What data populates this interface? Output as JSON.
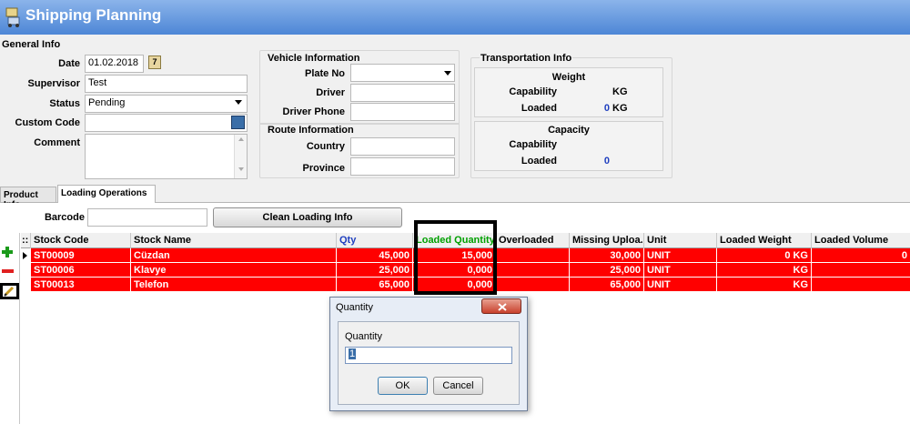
{
  "app": {
    "title": "Shipping Planning"
  },
  "general": {
    "section_title": "General Info",
    "date_label": "Date",
    "date_value": "01.02.2018",
    "supervisor_label": "Supervisor",
    "supervisor_value": "Test",
    "status_label": "Status",
    "status_value": "Pending",
    "custom_code_label": "Custom Code",
    "custom_code_value": "",
    "comment_label": "Comment",
    "comment_value": ""
  },
  "vehicle": {
    "section_title": "Vehicle Information",
    "plate_label": "Plate No",
    "plate_value": "",
    "driver_label": "Driver",
    "driver_value": "",
    "phone_label": "Driver Phone",
    "phone_value": ""
  },
  "route": {
    "section_title": "Route Information",
    "country_label": "Country",
    "country_value": "",
    "province_label": "Province",
    "province_value": ""
  },
  "transport": {
    "section_title": "Transportation Info",
    "weight": {
      "title": "Weight",
      "capability_label": "Capability",
      "capability_unit": "KG",
      "loaded_label": "Loaded",
      "loaded_value": "0",
      "loaded_unit": "KG"
    },
    "capacity": {
      "title": "Capacity",
      "capability_label": "Capability",
      "loaded_label": "Loaded",
      "loaded_value": "0"
    }
  },
  "tabs": [
    {
      "label": "Product Info"
    },
    {
      "label": "Loading Operations"
    }
  ],
  "loading": {
    "barcode_label": "Barcode",
    "barcode_value": "",
    "clean_button": "Clean Loading Info"
  },
  "grid": {
    "drag_handle": "::",
    "columns": [
      "Stock Code",
      "Stock Name",
      "Qty",
      "Loaded Quantity",
      "Overloaded",
      "Missing Uploa...",
      "Unit",
      "Loaded Weight",
      "Loaded Volume"
    ],
    "rows": [
      {
        "code": "ST00009",
        "name": "Cüzdan",
        "qty": "45,000",
        "loaded": "15,000",
        "overloaded": "",
        "missing": "30,000",
        "unit": "UNIT",
        "weight": "0 KG",
        "volume": "0"
      },
      {
        "code": "ST00006",
        "name": "Klavye",
        "qty": "25,000",
        "loaded": "0,000",
        "overloaded": "",
        "missing": "25,000",
        "unit": "UNIT",
        "weight": "KG",
        "volume": ""
      },
      {
        "code": "ST00013",
        "name": "Telefon",
        "qty": "65,000",
        "loaded": "0,000",
        "overloaded": "",
        "missing": "65,000",
        "unit": "UNIT",
        "weight": "KG",
        "volume": ""
      }
    ]
  },
  "icons": {
    "add": "plus-icon",
    "remove": "minus-icon",
    "edit": "pencil-icon",
    "calendar": "calendar-icon",
    "lookup": "lookup-icon",
    "close": "close-icon"
  },
  "colors": {
    "row_highlight": "#ff0000",
    "titlebar": "#4d86d6",
    "loaded_quantity_header": "#00a000",
    "qty_header": "#1f3fbf"
  },
  "dialog": {
    "title": "Quantity",
    "field_label": "Quantity",
    "field_value": "1",
    "ok": "OK",
    "cancel": "Cancel"
  }
}
